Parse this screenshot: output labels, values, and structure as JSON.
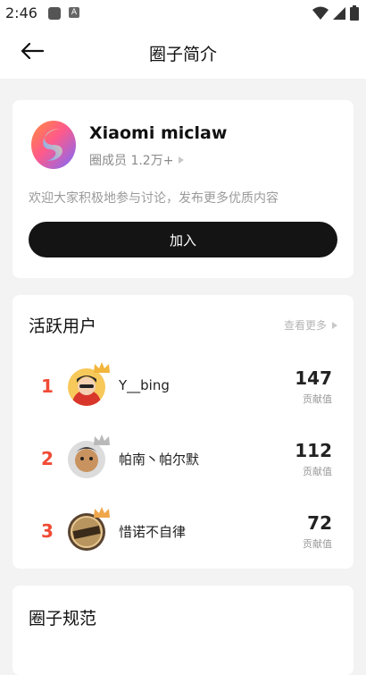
{
  "status": {
    "time": "2:46"
  },
  "header": {
    "title": "圈子简介"
  },
  "circle": {
    "name": "Xiaomi miclaw",
    "members": "圈成员 1.2万+",
    "description": "欢迎大家积极地参与讨论，发布更多优质内容",
    "join_label": "加入"
  },
  "active": {
    "title": "活跃用户",
    "see_more": "查看更多",
    "users": [
      {
        "rank": "1",
        "name": "Y__bing",
        "score": "147",
        "score_label": "贡献值"
      },
      {
        "rank": "2",
        "name": "帕南丶帕尔默",
        "score": "112",
        "score_label": "贡献值"
      },
      {
        "rank": "3",
        "name": "惜诺不自律",
        "score": "72",
        "score_label": "贡献值"
      }
    ]
  },
  "rules": {
    "title": "圈子规范"
  },
  "colors": {
    "rank": "#f04a35",
    "button": "#141414",
    "gold_crown": "#f2b53c",
    "silver_crown": "#b9b9b9"
  }
}
